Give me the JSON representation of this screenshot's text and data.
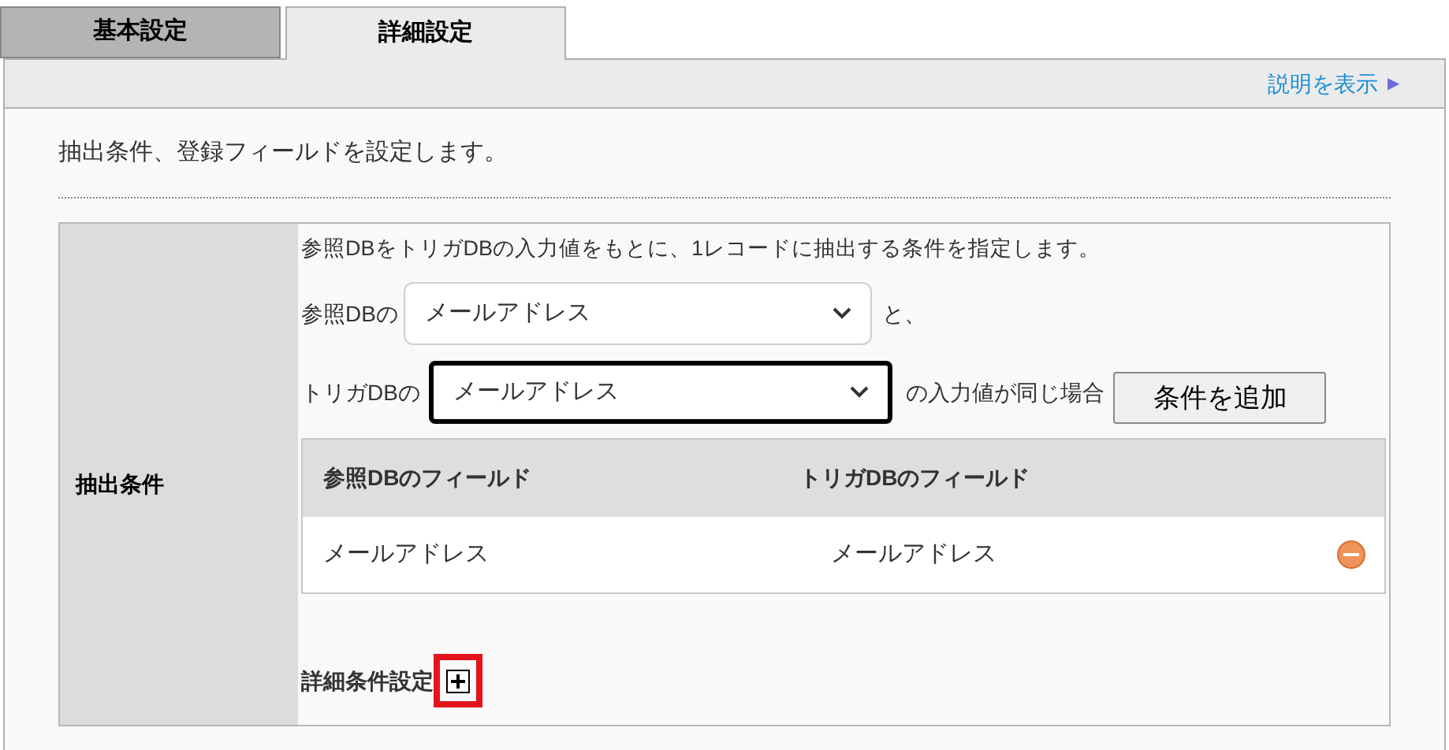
{
  "tabs": [
    {
      "label": "基本設定",
      "selected": false
    },
    {
      "label": "詳細設定",
      "selected": true
    }
  ],
  "help_link": {
    "label": "説明を表示",
    "arrow": "▶"
  },
  "description": "抽出条件、登録フィールドを設定します。",
  "section": {
    "label": "抽出条件",
    "intro": "参照DBをトリガDBの入力値をもとに、1レコードに抽出する条件を指定します。",
    "reference_row": {
      "prefix": "参照DBの",
      "value": "メールアドレス",
      "focused": false,
      "suffix": "と、"
    },
    "trigger_row": {
      "prefix": "トリガDBの",
      "value": "メールアドレス",
      "focused": true,
      "suffix": "の入力値が同じ場合",
      "button": "条件を追加"
    },
    "table": {
      "columns": [
        "参照DBのフィールド",
        "トリガDBのフィールド"
      ],
      "rows": [
        {
          "cells": [
            "メールアドレス",
            "メールアドレス"
          ]
        }
      ]
    },
    "detail": {
      "label": "詳細条件設定",
      "highlighted": true
    }
  }
}
